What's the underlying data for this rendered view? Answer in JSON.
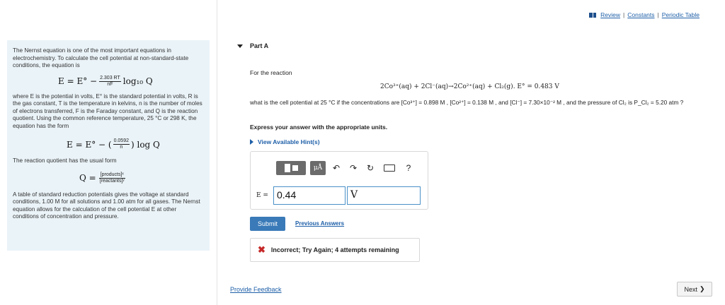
{
  "top_links": {
    "review": "Review",
    "constants": "Constants",
    "periodic_table": "Periodic Table",
    "separator": "|"
  },
  "info": {
    "intro": "The Nernst equation is one of the most important equations in electrochemistry. To calculate the cell potential at non-standard-state conditions, the equation is",
    "eq1_lhs": "E = E° −",
    "eq1_num": "2.303 RT",
    "eq1_den": "nF",
    "eq1_rhs": "log₁₀ Q",
    "where_text": "where E is the potential in volts, E° is the standard potential in volts, R is the gas constant, T is the temperature in kelvins, n is the number of moles of electrons transferred, F is the Faraday constant, and Q is the reaction quotient. Using the common reference temperature, 25 °C or 298 K, the equation has the form",
    "eq2_lhs": "E = E° − (",
    "eq2_num": "0.0592",
    "eq2_den": "n",
    "eq2_rhs": ") log Q",
    "quotient_text": "The reaction quotient has the usual form",
    "eq3_lhs": "Q =",
    "eq3_num": "[products]ˣ",
    "eq3_den": "[reactants]ʸ",
    "table_text": "A table of standard reduction potentials gives the voltage at standard conditions, 1.00 M for all solutions and 1.00 atm for all gases. The Nernst equation allows for the calculation of the cell potential E at other conditions of concentration and pressure."
  },
  "part": {
    "title": "Part A",
    "for_reaction": "For the reaction",
    "reaction": "2Co³⁺(aq) + 2Cl⁻(aq)→2Co²⁺(aq) + Cl₂(g).  E° = 0.483 V",
    "question": "what is the cell potential at 25 °C if the concentrations are [Co³⁺] = 0.898 M , [Co²⁺] = 0.138 M , and [Cl⁻] = 7.30×10⁻² M , and the pressure of Cl₂ is P_Cl₂ = 5.20 atm ?",
    "units_instruction": "Express your answer with the appropriate units.",
    "hint_link": "View Available Hint(s)"
  },
  "answer": {
    "label": "E =",
    "value": "0.44",
    "unit": "V",
    "units_button": "μÅ",
    "help": "?"
  },
  "actions": {
    "submit": "Submit",
    "previous_answers": "Previous Answers",
    "feedback_message": "Incorrect; Try Again; 4 attempts remaining",
    "provide_feedback": "Provide Feedback",
    "next": "Next",
    "next_chevron": "❯"
  },
  "colors": {
    "link": "#1e5fa8",
    "submit": "#3a7ab8",
    "error": "#c62828",
    "info_bg": "#eaf3f8"
  }
}
